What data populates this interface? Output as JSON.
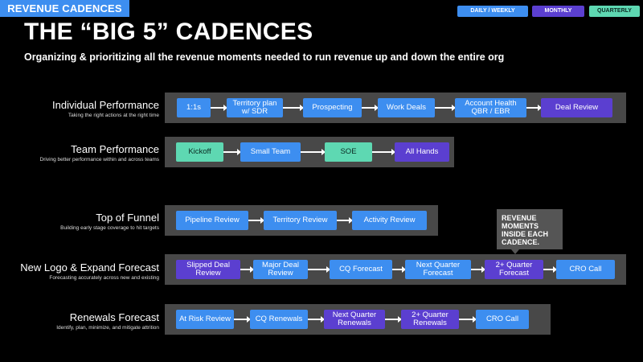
{
  "header": {
    "tag": "REVENUE CADENCES",
    "title": "THE “BIG 5” CADENCES",
    "subtitle": "Organizing & prioritizing all the revenue moments needed to run revenue up and down the entire org"
  },
  "legend": {
    "daily_weekly": "DAILY / WEEKLY",
    "monthly": "MONTHLY",
    "quarterly": "QUARTERLY"
  },
  "colors": {
    "daily_weekly": "#3d8ef0",
    "monthly": "#5b3fd0",
    "quarterly": "#5ed8b2"
  },
  "rows": [
    {
      "title": "Individual Performance",
      "desc": "Taking the right actions at the right time",
      "steps": [
        {
          "label": "1:1s",
          "type": "daily_weekly"
        },
        {
          "label": "Territory plan w/ SDR",
          "type": "daily_weekly"
        },
        {
          "label": "Prospecting",
          "type": "daily_weekly"
        },
        {
          "label": "Work Deals",
          "type": "daily_weekly"
        },
        {
          "label": "Account Health QBR / EBR",
          "type": "daily_weekly"
        },
        {
          "label": "Deal Review",
          "type": "monthly"
        }
      ]
    },
    {
      "title": "Team Performance",
      "desc": "Driving better performance within and across teams",
      "steps": [
        {
          "label": "Kickoff",
          "type": "quarterly"
        },
        {
          "label": "Small Team",
          "type": "daily_weekly"
        },
        {
          "label": "SOE",
          "type": "quarterly"
        },
        {
          "label": "All Hands",
          "type": "monthly"
        }
      ]
    },
    {
      "title": "Top of Funnel",
      "desc": "Building early stage coverage to hit targets",
      "steps": [
        {
          "label": "Pipeline Review",
          "type": "daily_weekly"
        },
        {
          "label": "Territory Review",
          "type": "daily_weekly"
        },
        {
          "label": "Activity Review",
          "type": "daily_weekly"
        }
      ]
    },
    {
      "title": "New Logo & Expand Forecast",
      "desc": "Forecasting accurately across new and existing",
      "steps": [
        {
          "label": "Slipped Deal Review",
          "type": "monthly"
        },
        {
          "label": "Major Deal Review",
          "type": "daily_weekly"
        },
        {
          "label": "CQ Forecast",
          "type": "daily_weekly"
        },
        {
          "label": "Next Quarter Forecast",
          "type": "daily_weekly"
        },
        {
          "label": "2+ Quarter Forecast",
          "type": "monthly"
        },
        {
          "label": "CRO Call",
          "type": "daily_weekly"
        }
      ]
    },
    {
      "title": "Renewals Forecast",
      "desc": "Identify, plan, minimize, and mitigate attrition",
      "steps": [
        {
          "label": "At Risk Review",
          "type": "daily_weekly"
        },
        {
          "label": "CQ Renewals",
          "type": "daily_weekly"
        },
        {
          "label": "Next Quarter Renewals",
          "type": "monthly"
        },
        {
          "label": "2+ Quarter Renewals",
          "type": "monthly"
        },
        {
          "label": "CRO Call",
          "type": "daily_weekly"
        }
      ]
    }
  ],
  "callout": "REVENUE MOMENTS INSIDE EACH CADENCE."
}
